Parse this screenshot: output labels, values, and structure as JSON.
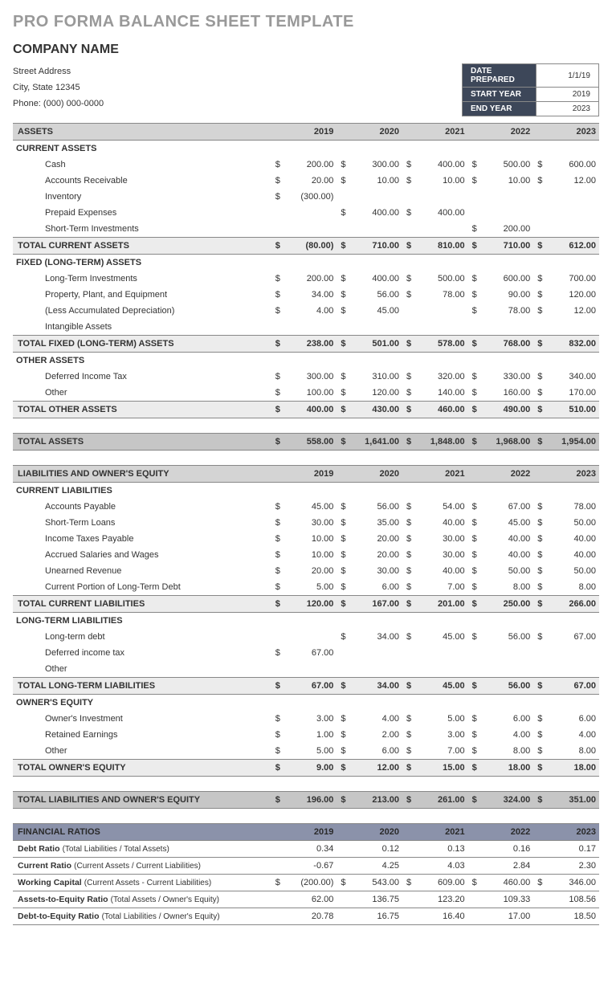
{
  "title": "PRO FORMA BALANCE SHEET TEMPLATE",
  "company": "COMPANY NAME",
  "addr1": "Street Address",
  "addr2": "City, State  12345",
  "addr3": "Phone: (000) 000-0000",
  "meta": {
    "datePreparedLbl": "DATE PREPARED",
    "datePrepared": "1/1/19",
    "startYearLbl": "START YEAR",
    "startYear": "2019",
    "endYearLbl": "END YEAR",
    "endYear": "2023"
  },
  "years": [
    "2019",
    "2020",
    "2021",
    "2022",
    "2023"
  ],
  "assetsHdr": "ASSETS",
  "currentAssets": {
    "hdr": "CURRENT ASSETS",
    "rows": [
      {
        "l": "Cash",
        "d": [
          "$",
          "$",
          "$",
          "$",
          "$"
        ],
        "v": [
          "200.00",
          "300.00",
          "400.00",
          "500.00",
          "600.00"
        ]
      },
      {
        "l": "Accounts Receivable",
        "d": [
          "$",
          "$",
          "$",
          "$",
          "$"
        ],
        "v": [
          "20.00",
          "10.00",
          "10.00",
          "10.00",
          "12.00"
        ]
      },
      {
        "l": "Inventory",
        "d": [
          "$",
          "",
          "",
          "",
          ""
        ],
        "v": [
          "(300.00)",
          "",
          "",
          "",
          ""
        ]
      },
      {
        "l": "Prepaid Expenses",
        "d": [
          "",
          "$",
          "$",
          "",
          ""
        ],
        "v": [
          "",
          "400.00",
          "400.00",
          "",
          ""
        ]
      },
      {
        "l": "Short-Term Investments",
        "d": [
          "",
          "",
          "",
          "$",
          ""
        ],
        "v": [
          "",
          "",
          "",
          "200.00",
          ""
        ]
      }
    ],
    "total": {
      "l": "TOTAL CURRENT ASSETS",
      "d": [
        "$",
        "$",
        "$",
        "$",
        "$"
      ],
      "v": [
        "(80.00)",
        "710.00",
        "810.00",
        "710.00",
        "612.00"
      ]
    }
  },
  "fixedAssets": {
    "hdr": "FIXED (LONG-TERM) ASSETS",
    "rows": [
      {
        "l": "Long-Term Investments",
        "d": [
          "$",
          "$",
          "$",
          "$",
          "$"
        ],
        "v": [
          "200.00",
          "400.00",
          "500.00",
          "600.00",
          "700.00"
        ]
      },
      {
        "l": "Property, Plant, and Equipment",
        "d": [
          "$",
          "$",
          "$",
          "$",
          "$"
        ],
        "v": [
          "34.00",
          "56.00",
          "78.00",
          "90.00",
          "120.00"
        ]
      },
      {
        "l": "(Less Accumulated Depreciation)",
        "d": [
          "$",
          "$",
          "",
          "$",
          "$"
        ],
        "v": [
          "4.00",
          "45.00",
          "",
          "78.00",
          "12.00"
        ]
      },
      {
        "l": "Intangible Assets",
        "d": [
          "",
          "",
          "",
          "",
          ""
        ],
        "v": [
          "",
          "",
          "",
          "",
          ""
        ]
      }
    ],
    "total": {
      "l": "TOTAL FIXED (LONG-TERM) ASSETS",
      "d": [
        "$",
        "$",
        "$",
        "$",
        "$"
      ],
      "v": [
        "238.00",
        "501.00",
        "578.00",
        "768.00",
        "832.00"
      ]
    }
  },
  "otherAssets": {
    "hdr": "OTHER ASSETS",
    "rows": [
      {
        "l": "Deferred Income Tax",
        "d": [
          "$",
          "$",
          "$",
          "$",
          "$"
        ],
        "v": [
          "300.00",
          "310.00",
          "320.00",
          "330.00",
          "340.00"
        ]
      },
      {
        "l": "Other",
        "d": [
          "$",
          "$",
          "$",
          "$",
          "$"
        ],
        "v": [
          "100.00",
          "120.00",
          "140.00",
          "160.00",
          "170.00"
        ]
      }
    ],
    "total": {
      "l": "TOTAL OTHER ASSETS",
      "d": [
        "$",
        "$",
        "$",
        "$",
        "$"
      ],
      "v": [
        "400.00",
        "430.00",
        "460.00",
        "490.00",
        "510.00"
      ]
    }
  },
  "totalAssets": {
    "l": "TOTAL ASSETS",
    "d": [
      "$",
      "$",
      "$",
      "$",
      "$"
    ],
    "v": [
      "558.00",
      "1,641.00",
      "1,848.00",
      "1,968.00",
      "1,954.00"
    ]
  },
  "liabHdr": "LIABILITIES AND OWNER'S EQUITY",
  "currentLiab": {
    "hdr": "CURRENT LIABILITIES",
    "rows": [
      {
        "l": "Accounts Payable",
        "d": [
          "$",
          "$",
          "$",
          "$",
          "$"
        ],
        "v": [
          "45.00",
          "56.00",
          "54.00",
          "67.00",
          "78.00"
        ]
      },
      {
        "l": "Short-Term Loans",
        "d": [
          "$",
          "$",
          "$",
          "$",
          "$"
        ],
        "v": [
          "30.00",
          "35.00",
          "40.00",
          "45.00",
          "50.00"
        ]
      },
      {
        "l": "Income Taxes Payable",
        "d": [
          "$",
          "$",
          "$",
          "$",
          "$"
        ],
        "v": [
          "10.00",
          "20.00",
          "30.00",
          "40.00",
          "40.00"
        ]
      },
      {
        "l": "Accrued Salaries and Wages",
        "d": [
          "$",
          "$",
          "$",
          "$",
          "$"
        ],
        "v": [
          "10.00",
          "20.00",
          "30.00",
          "40.00",
          "40.00"
        ]
      },
      {
        "l": "Unearned Revenue",
        "d": [
          "$",
          "$",
          "$",
          "$",
          "$"
        ],
        "v": [
          "20.00",
          "30.00",
          "40.00",
          "50.00",
          "50.00"
        ]
      },
      {
        "l": "Current Portion of Long-Term Debt",
        "d": [
          "$",
          "$",
          "$",
          "$",
          "$"
        ],
        "v": [
          "5.00",
          "6.00",
          "7.00",
          "8.00",
          "8.00"
        ]
      }
    ],
    "total": {
      "l": "TOTAL CURRENT LIABILITIES",
      "d": [
        "$",
        "$",
        "$",
        "$",
        "$"
      ],
      "v": [
        "120.00",
        "167.00",
        "201.00",
        "250.00",
        "266.00"
      ]
    }
  },
  "longLiab": {
    "hdr": "LONG-TERM LIABILITIES",
    "rows": [
      {
        "l": "Long-term debt",
        "d": [
          "",
          "$",
          "$",
          "$",
          "$"
        ],
        "v": [
          "",
          "34.00",
          "45.00",
          "56.00",
          "67.00"
        ]
      },
      {
        "l": "Deferred income tax",
        "d": [
          "$",
          "",
          "",
          "",
          ""
        ],
        "v": [
          "67.00",
          "",
          "",
          "",
          ""
        ]
      },
      {
        "l": "Other",
        "d": [
          "",
          "",
          "",
          "",
          ""
        ],
        "v": [
          "",
          "",
          "",
          "",
          ""
        ]
      }
    ],
    "total": {
      "l": "TOTAL LONG-TERM LIABILITIES",
      "d": [
        "$",
        "$",
        "$",
        "$",
        "$"
      ],
      "v": [
        "67.00",
        "34.00",
        "45.00",
        "56.00",
        "67.00"
      ]
    }
  },
  "equity": {
    "hdr": "OWNER'S EQUITY",
    "rows": [
      {
        "l": "Owner's Investment",
        "d": [
          "$",
          "$",
          "$",
          "$",
          "$"
        ],
        "v": [
          "3.00",
          "4.00",
          "5.00",
          "6.00",
          "6.00"
        ]
      },
      {
        "l": "Retained Earnings",
        "d": [
          "$",
          "$",
          "$",
          "$",
          "$"
        ],
        "v": [
          "1.00",
          "2.00",
          "3.00",
          "4.00",
          "4.00"
        ]
      },
      {
        "l": "Other",
        "d": [
          "$",
          "$",
          "$",
          "$",
          "$"
        ],
        "v": [
          "5.00",
          "6.00",
          "7.00",
          "8.00",
          "8.00"
        ]
      }
    ],
    "total": {
      "l": "TOTAL OWNER'S EQUITY",
      "d": [
        "$",
        "$",
        "$",
        "$",
        "$"
      ],
      "v": [
        "9.00",
        "12.00",
        "15.00",
        "18.00",
        "18.00"
      ]
    }
  },
  "totalLiab": {
    "l": "TOTAL LIABILITIES AND OWNER'S EQUITY",
    "d": [
      "$",
      "$",
      "$",
      "$",
      "$"
    ],
    "v": [
      "196.00",
      "213.00",
      "261.00",
      "324.00",
      "351.00"
    ]
  },
  "ratiosHdr": "FINANCIAL RATIOS",
  "ratios": [
    {
      "n": "Debt Ratio",
      "desc": "(Total Liabilities / Total Assets)",
      "d": [
        "",
        "",
        "",
        "",
        ""
      ],
      "v": [
        "0.34",
        "0.12",
        "0.13",
        "0.16",
        "0.17"
      ]
    },
    {
      "n": "Current Ratio",
      "desc": "(Current Assets / Current Liabilities)",
      "d": [
        "",
        "",
        "",
        "",
        ""
      ],
      "v": [
        "-0.67",
        "4.25",
        "4.03",
        "2.84",
        "2.30"
      ]
    },
    {
      "n": "Working Capital",
      "desc": "(Current Assets - Current Liabilities)",
      "d": [
        "$",
        "$",
        "$",
        "$",
        "$"
      ],
      "v": [
        "(200.00)",
        "543.00",
        "609.00",
        "460.00",
        "346.00"
      ]
    },
    {
      "n": "Assets-to-Equity Ratio",
      "desc": "(Total Assets / Owner's Equity)",
      "d": [
        "",
        "",
        "",
        "",
        ""
      ],
      "v": [
        "62.00",
        "136.75",
        "123.20",
        "109.33",
        "108.56"
      ]
    },
    {
      "n": "Debt-to-Equity Ratio",
      "desc": "(Total Liabilities / Owner's Equity)",
      "d": [
        "",
        "",
        "",
        "",
        ""
      ],
      "v": [
        "20.78",
        "16.75",
        "16.40",
        "17.00",
        "18.50"
      ]
    }
  ]
}
